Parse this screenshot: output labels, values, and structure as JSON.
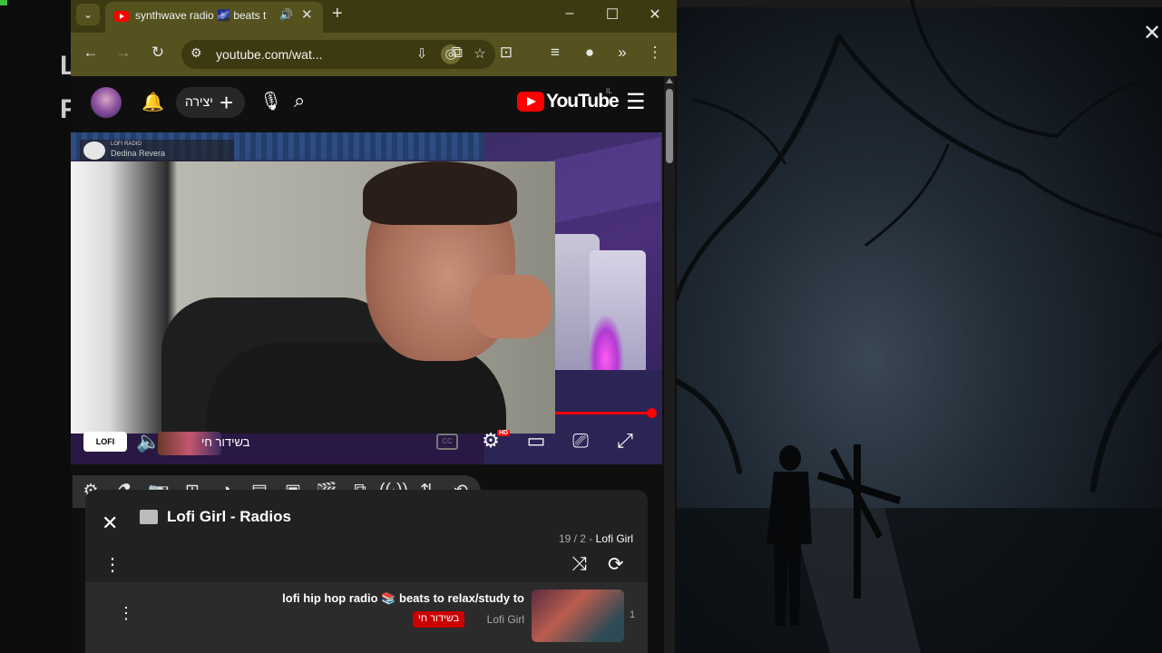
{
  "tab": {
    "title": "synthwave radio 🌌 beats t",
    "new_tab": "+"
  },
  "window": {
    "minimize": "–",
    "maximize": "☐",
    "close": "✕"
  },
  "address_bar": {
    "url": "youtube.com/wat..."
  },
  "youtube": {
    "create_label": "יצירה",
    "logo_text": "YouTube",
    "country_code": "IL"
  },
  "video": {
    "channel_line1": "LOFI RADIO",
    "channel_line2": "Dedina  Revera",
    "progress_fraction": 0.99
  },
  "controls": {
    "lofi_label": "LOFI",
    "live_label": "בשידור חי",
    "hd_label": "HD"
  },
  "playlist": {
    "title": "Lofi Girl - Radios",
    "position": "19 / 2 -",
    "owner": "Lofi Girl",
    "items": [
      {
        "title": "lofi hip hop radio 📚 beats to relax/study to",
        "badge": "בשידור חי",
        "channel": "Lofi Girl",
        "index": "1"
      }
    ]
  },
  "background_window": {
    "letter1": "L",
    "letter2": "F"
  },
  "colors": {
    "youtube_red": "#ff0000",
    "browser_theme": "#55521f"
  }
}
